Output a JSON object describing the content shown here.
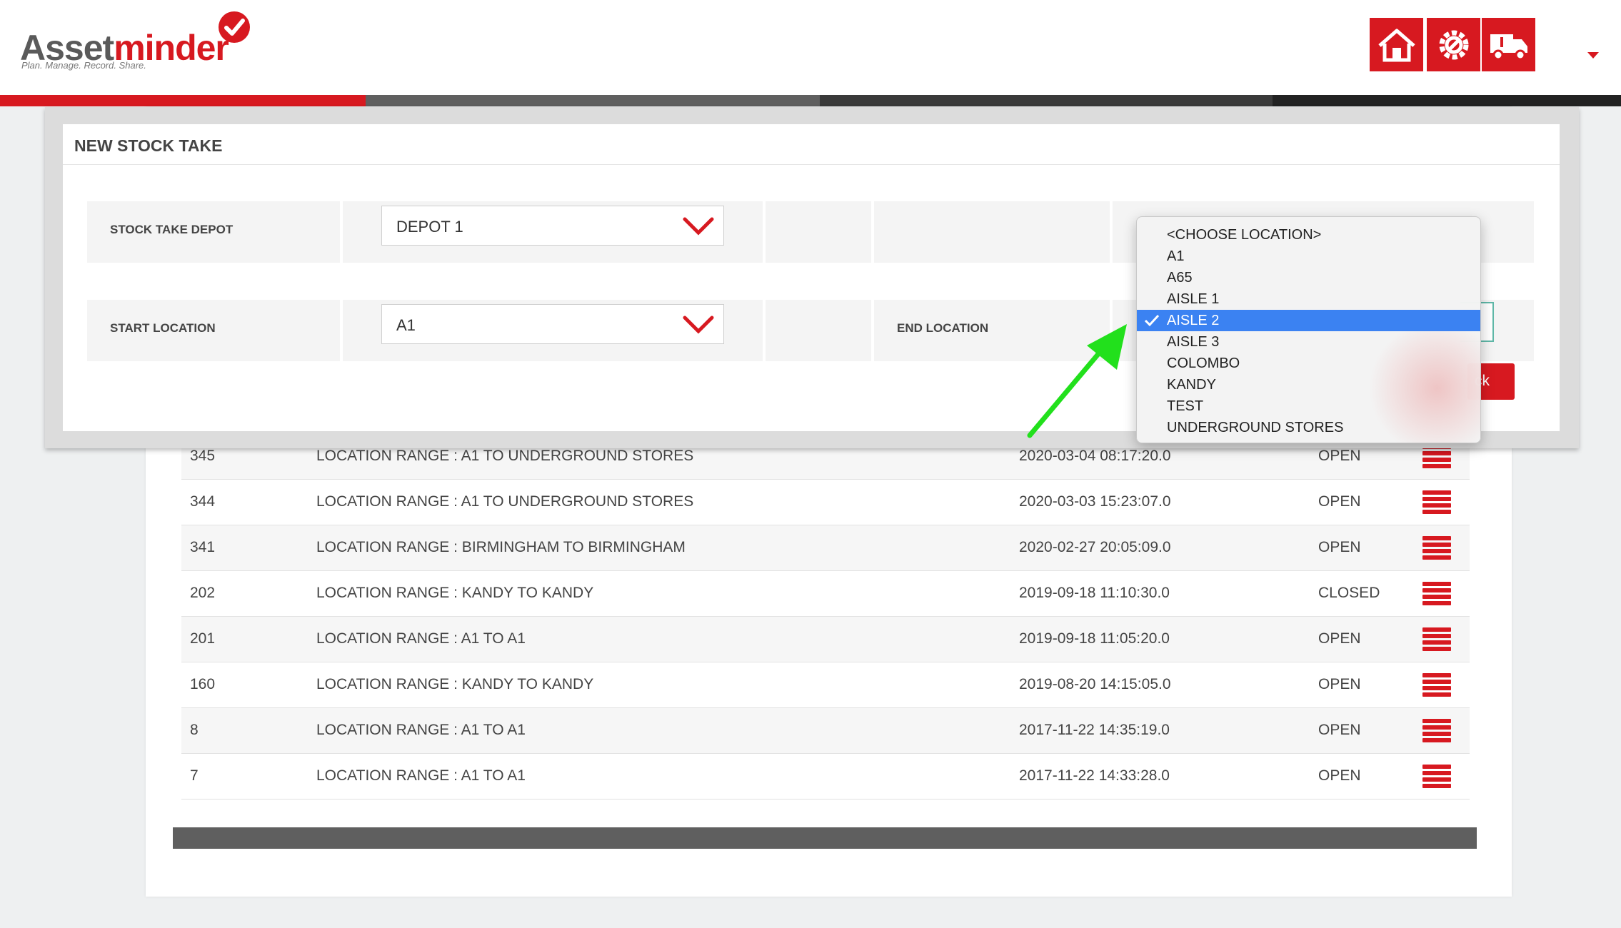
{
  "header": {
    "logo_main_a": "Asset",
    "logo_main_b": "minder",
    "logo_tagline": "Plan. Manage. Record. Share.",
    "nav": [
      {
        "icon": "home-icon"
      },
      {
        "icon": "settings-gear-icon"
      },
      {
        "icon": "truck-icon"
      }
    ],
    "accent_color": "#d71920"
  },
  "modal": {
    "title": "NEW STOCK TAKE",
    "depot_label": "STOCK TAKE DEPOT",
    "depot_value": "DEPOT 1",
    "start_label": "START LOCATION",
    "start_value": "A1",
    "end_label": "END LOCATION",
    "action_button_partial": "ck"
  },
  "dropdown": {
    "options": [
      {
        "label": "<CHOOSE LOCATION>",
        "selected": false
      },
      {
        "label": "A1",
        "selected": false
      },
      {
        "label": "A65",
        "selected": false
      },
      {
        "label": "AISLE 1",
        "selected": false
      },
      {
        "label": "AISLE 2",
        "selected": true
      },
      {
        "label": "AISLE 3",
        "selected": false
      },
      {
        "label": "COLOMBO",
        "selected": false
      },
      {
        "label": "KANDY",
        "selected": false
      },
      {
        "label": "TEST",
        "selected": false
      },
      {
        "label": "UNDERGROUND STORES",
        "selected": false
      }
    ],
    "selection_color": "#3b82f2"
  },
  "table": {
    "rows": [
      {
        "id": "345",
        "description": "LOCATION RANGE : A1 TO UNDERGROUND STORES",
        "date": "2020-03-04 08:17:20.0",
        "status": "OPEN"
      },
      {
        "id": "344",
        "description": "LOCATION RANGE : A1 TO UNDERGROUND STORES",
        "date": "2020-03-03 15:23:07.0",
        "status": "OPEN"
      },
      {
        "id": "341",
        "description": "LOCATION RANGE : BIRMINGHAM TO BIRMINGHAM",
        "date": "2020-02-27 20:05:09.0",
        "status": "OPEN"
      },
      {
        "id": "202",
        "description": "LOCATION RANGE : KANDY TO KANDY",
        "date": "2019-09-18 11:10:30.0",
        "status": "CLOSED"
      },
      {
        "id": "201",
        "description": "LOCATION RANGE : A1 TO A1",
        "date": "2019-09-18 11:05:20.0",
        "status": "OPEN"
      },
      {
        "id": "160",
        "description": "LOCATION RANGE : KANDY TO KANDY",
        "date": "2019-08-20 14:15:05.0",
        "status": "OPEN"
      },
      {
        "id": "8",
        "description": "LOCATION RANGE : A1 TO A1",
        "date": "2017-11-22 14:35:19.0",
        "status": "OPEN"
      },
      {
        "id": "7",
        "description": "LOCATION RANGE : A1 TO A1",
        "date": "2017-11-22 14:33:28.0",
        "status": "OPEN"
      }
    ]
  },
  "annotation": {
    "arrow_color": "#22e01c"
  }
}
